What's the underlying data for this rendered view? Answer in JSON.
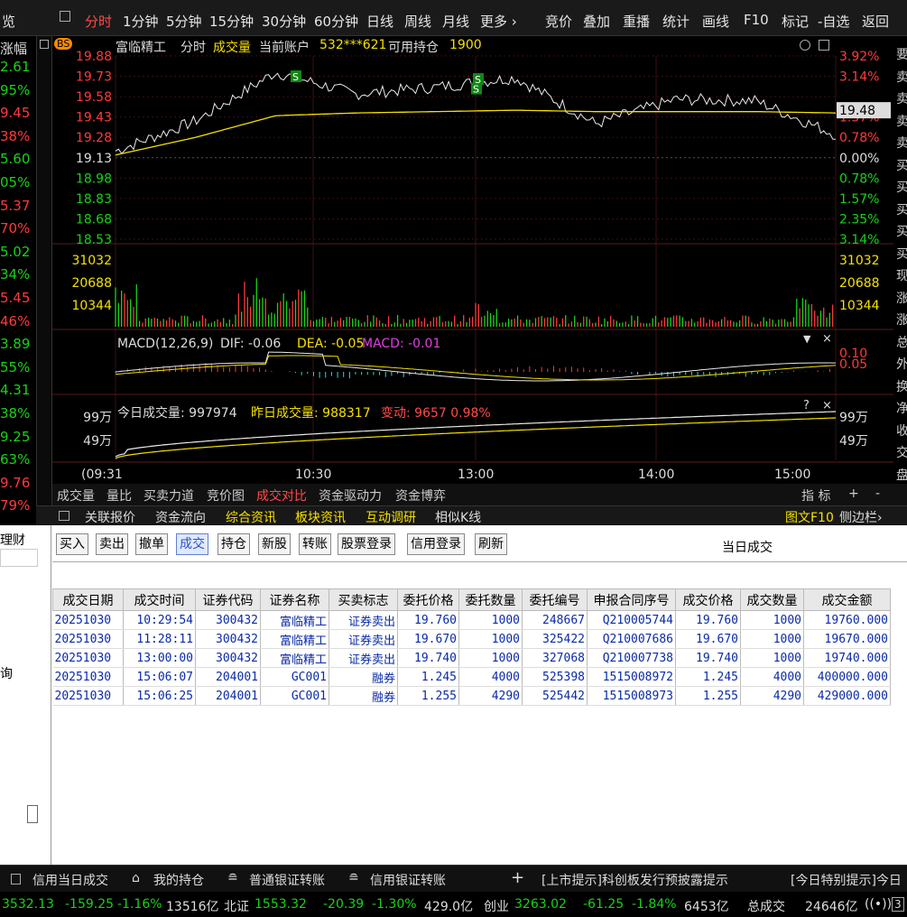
{
  "colors": {
    "up": "#ff3a3a",
    "down": "#19d219",
    "yellow": "#f5e000",
    "text": "#dddddd",
    "cyan": "#35d6d6",
    "magenta": "#e040e0"
  },
  "topbar": {
    "left_label": "览",
    "tabs": [
      "分时",
      "1分钟",
      "5分钟",
      "15分钟",
      "30分钟",
      "60分钟",
      "日线",
      "周线",
      "月线",
      "更多 ›"
    ],
    "right_items": [
      "竞价",
      "叠加",
      "重播",
      "统计",
      "画线",
      "F10",
      "标记",
      "-自选",
      "返回"
    ]
  },
  "left_column": {
    "header": "涨幅",
    "values": [
      "2.61",
      "95%",
      "9.45",
      "38%",
      "5.60",
      "05%",
      "5.37",
      "70%",
      "5.02",
      "34%",
      "5.45",
      "46%",
      "3.89",
      "55%",
      "4.31",
      "38%",
      "9.25",
      "63%",
      "9.76",
      "79%"
    ]
  },
  "right_column": {
    "chars": [
      "要",
      "卖",
      "卖",
      "卖",
      "卖",
      "买",
      "买",
      "买",
      "买",
      "买",
      "现",
      "涨",
      "涨",
      "总",
      "外",
      "换",
      "净",
      "收",
      "交",
      "盘"
    ]
  },
  "chart": {
    "stock": "富临精工",
    "mode": "分时",
    "volume_label": "成交量",
    "account_label": "当前账户",
    "account": "532***621",
    "holding_label": "可用持仓",
    "holding": "1900",
    "bs_badge": "BS",
    "price_ticks": [
      "19.88",
      "19.73",
      "19.58",
      "19.43",
      "19.28",
      "19.13",
      "18.98",
      "18.83",
      "18.68",
      "18.53"
    ],
    "pct_ticks": [
      "3.92%",
      "3.14%",
      "",
      "1.57%",
      "0.78%",
      "0.00%",
      "0.78%",
      "1.57%",
      "2.35%",
      "3.14%"
    ],
    "current_price": "19.48",
    "vol_ticks": [
      "31032",
      "20688",
      "10344"
    ],
    "macd_label": "MACD(12,26,9)",
    "dif_label": "DIF: -0.06",
    "dea_label": "DEA: -0.05",
    "macd_value": "MACD: -0.01",
    "macd_ticks": [
      "0.10",
      "0.05"
    ],
    "sub_today": "今日成交量: 997974",
    "sub_yest": "昨日成交量: 988317",
    "sub_change": "变动: 9657 0.98%",
    "sub_ticks": [
      "99万",
      "49万"
    ],
    "time_ticks": [
      "(09:31",
      "10:30",
      "13:00",
      "14:00",
      "15:00"
    ],
    "sell_marker": "S"
  },
  "chart_data": {
    "type": "line",
    "x": [
      "09:31",
      "10:00",
      "10:30",
      "11:00",
      "11:30",
      "13:00",
      "13:30",
      "14:00",
      "14:30",
      "15:00"
    ],
    "series": [
      {
        "values": [
          19.18,
          19.4,
          19.76,
          19.6,
          19.65,
          19.72,
          19.38,
          19.56,
          19.55,
          19.3
        ]
      },
      {
        "values": [
          19.15,
          19.28,
          19.44,
          19.46,
          19.47,
          19.48,
          19.47,
          19.47,
          19.47,
          19.46
        ]
      }
    ],
    "ylim": [
      18.53,
      19.88
    ]
  },
  "chart_tabs": [
    "成交量",
    "量比",
    "买卖力道",
    "竞价图",
    "成交对比",
    "资金驱动力",
    "资金博弈"
  ],
  "chart_tabs_right": [
    "指 标",
    "+",
    "-"
  ],
  "info_tabs": [
    "关联报价",
    "资金流向",
    "综合资讯",
    "板块资讯",
    "互动调研",
    "相似K线"
  ],
  "info_right": [
    "图文F10",
    "侧边栏›"
  ],
  "left_panel": {
    "title": "理财",
    "item": "询"
  },
  "toolbar": {
    "buttons": [
      "买入",
      "卖出",
      "撤单",
      "成交",
      "持仓",
      "新股",
      "转账",
      "股票登录",
      "信用登录",
      "刷新"
    ],
    "title": "当日成交"
  },
  "table": {
    "headers": [
      "成交日期",
      "成交时间",
      "证券代码",
      "证券名称",
      "买卖标志",
      "委托价格",
      "委托数量",
      "委托编号",
      "申报合同序号",
      "成交价格",
      "成交数量",
      "成交金额"
    ],
    "rows": [
      [
        "20251030",
        "10:29:54",
        "300432",
        "富临精工",
        "证券卖出",
        "19.760",
        "1000",
        "248667",
        "Q210005744",
        "19.760",
        "1000",
        "19760.000"
      ],
      [
        "20251030",
        "11:28:11",
        "300432",
        "富临精工",
        "证券卖出",
        "19.670",
        "1000",
        "325422",
        "Q210007686",
        "19.670",
        "1000",
        "19670.000"
      ],
      [
        "20251030",
        "13:00:00",
        "300432",
        "富临精工",
        "证券卖出",
        "19.740",
        "1000",
        "327068",
        "Q210007738",
        "19.740",
        "1000",
        "19740.000"
      ],
      [
        "20251030",
        "15:06:07",
        "204001",
        "GC001",
        "融券",
        "1.245",
        "4000",
        "525398",
        "1515008972",
        "1.245",
        "4000",
        "400000.000"
      ],
      [
        "20251030",
        "15:06:25",
        "204001",
        "GC001",
        "融券",
        "1.255",
        "4290",
        "525442",
        "1515008973",
        "1.255",
        "4290",
        "429000.000"
      ]
    ]
  },
  "bottom_tabs": [
    "信用当日成交",
    "我的持仓",
    "普通银证转账",
    "信用银证转账"
  ],
  "ticker": "[上市提示]科创板发行预披露提示",
  "ticker2": "[今日特别提示]今日",
  "index_bar": {
    "sh_value": "3532.13",
    "sh_change": "-159.25",
    "sh_pct": "-1.16%",
    "sh_amt": "13516亿",
    "bz_label": "北证",
    "bz_value": "1553.32",
    "bz_change": "-20.39",
    "bz_pct": "-1.30%",
    "bz_amt": "429.0亿",
    "cy_label": "创业",
    "cy_value": "3263.02",
    "cy_change": "-61.25",
    "cy_pct": "-1.84%",
    "cy_amt": "6453亿",
    "total_label": "总成交",
    "total": "24646亿",
    "page": "3"
  }
}
